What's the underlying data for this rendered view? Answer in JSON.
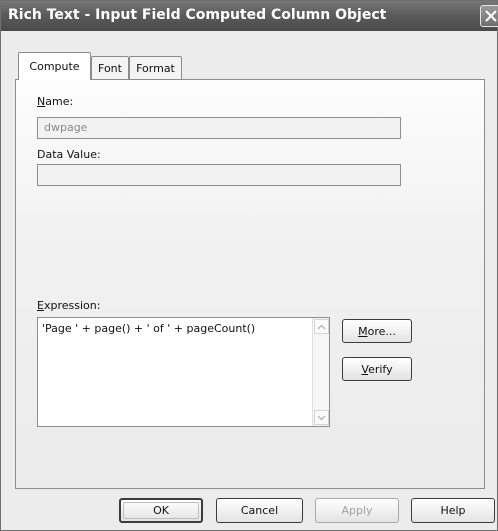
{
  "window": {
    "title": "Rich Text - Input Field Computed Column Object"
  },
  "tabs": [
    {
      "label": "Compute",
      "active": true
    },
    {
      "label": "Font",
      "active": false
    },
    {
      "label": "Format",
      "active": false
    }
  ],
  "compute": {
    "name_label_mnemonic": "N",
    "name_label_rest": "ame:",
    "name_value": "dwpage",
    "data_value_label": "Data Value:",
    "data_value": "",
    "expression_label_mnemonic": "E",
    "expression_label_rest": "xpression:",
    "expression_value": "'Page ' + page() + ' of ' + pageCount()",
    "more_label_mnemonic": "M",
    "more_label_rest": "ore...",
    "verify_label_mnemonic": "V",
    "verify_label_rest": "erify"
  },
  "footer": {
    "ok_label": "OK",
    "cancel_label": "Cancel",
    "apply_label": "Apply",
    "apply_enabled": false,
    "help_label": "Help"
  },
  "icons": {
    "close": "close-icon",
    "scroll_up": "chevron-up-icon",
    "scroll_down": "chevron-down-icon"
  }
}
